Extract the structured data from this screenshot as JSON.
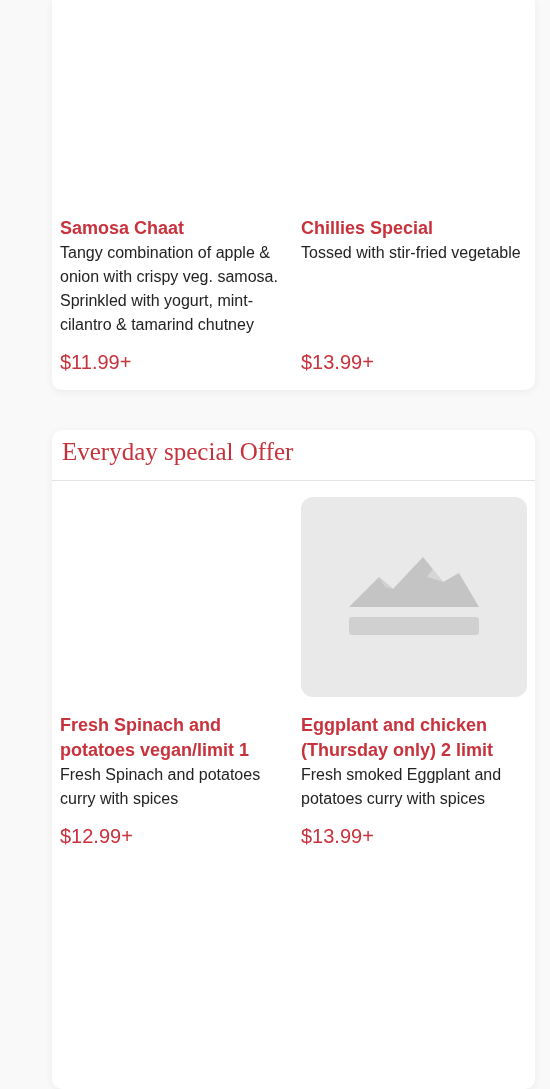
{
  "sections": [
    {
      "items": [
        {
          "name": "Samosa Chaat",
          "description": "Tangy combination of apple & onion with crispy veg. samosa. Sprinkled with yogurt, mint-cilantro & tamarind chutney",
          "price": "$11.99+"
        },
        {
          "name": "Chillies Special",
          "description": "Tossed with stir-fried vegetable",
          "price": "$13.99+"
        }
      ]
    },
    {
      "title": "Everyday special Offer",
      "items": [
        {
          "name": "Fresh Spinach and potatoes vegan/limit 1",
          "description": "Fresh Spinach and potatoes curry with spices",
          "price": "$12.99+"
        },
        {
          "name": "Eggplant and chicken (Thursday only) 2 limit",
          "description": "Fresh smoked Eggplant and potatoes curry with spices",
          "price": "$13.99+"
        }
      ]
    }
  ]
}
